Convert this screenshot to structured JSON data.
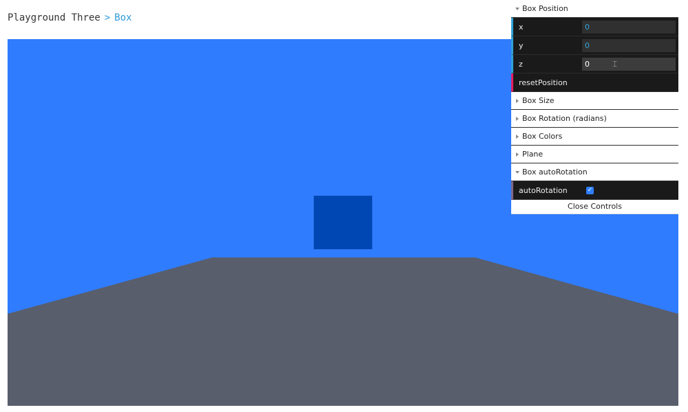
{
  "breadcrumb": {
    "root": "Playground Three",
    "separator": ">",
    "current": "Box"
  },
  "scene": {
    "sky_color": "#2f7cff",
    "floor_color": "#595e6c",
    "box_color": "#0047b3"
  },
  "gui": {
    "folders": {
      "box_position": "Box Position",
      "box_size": "Box Size",
      "box_rotation": "Box Rotation (radians)",
      "box_colors": "Box Colors",
      "plane": "Plane",
      "box_autorotation": "Box autoRotation"
    },
    "position": {
      "x_label": "x",
      "x_value": "0",
      "y_label": "y",
      "y_value": "0",
      "z_label": "z",
      "z_value": "0"
    },
    "reset_label": "resetPosition",
    "autorotation_label": "autoRotation",
    "autorotation_checked": true,
    "close_label": "Close Controls"
  }
}
